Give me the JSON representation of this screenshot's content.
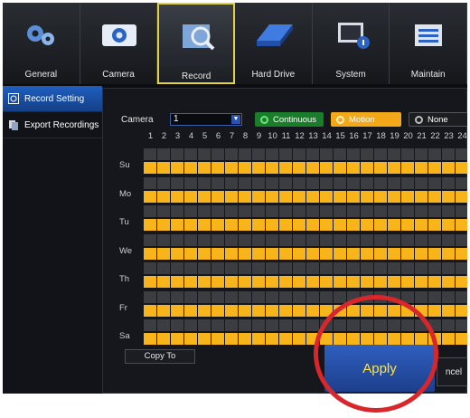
{
  "topbar": {
    "tabs": [
      {
        "label": "General",
        "icon": "gears-icon"
      },
      {
        "label": "Camera",
        "icon": "camera-icon"
      },
      {
        "label": "Record",
        "icon": "record-magnifier-icon"
      },
      {
        "label": "Hard Drive",
        "icon": "hard-drive-icon"
      },
      {
        "label": "System",
        "icon": "system-info-icon"
      },
      {
        "label": "Maintain",
        "icon": "maintain-sliders-icon"
      }
    ],
    "active_tab": "Record"
  },
  "sidebar": {
    "items": [
      {
        "label": "Record Setting",
        "icon": "record-setting-icon"
      },
      {
        "label": "Export Recordings",
        "icon": "export-icon"
      }
    ]
  },
  "schedule": {
    "camera_label": "Camera",
    "camera_value": "1",
    "modes": [
      {
        "label": "Continuous",
        "color": "#1a7d2a"
      },
      {
        "label": "Motion",
        "color": "#f3a81a"
      },
      {
        "label": "None",
        "color": "#1c1d21"
      }
    ],
    "hours": [
      "1",
      "2",
      "3",
      "4",
      "5",
      "6",
      "7",
      "8",
      "9",
      "10",
      "11",
      "12",
      "13",
      "14",
      "15",
      "16",
      "17",
      "18",
      "19",
      "20",
      "21",
      "22",
      "23",
      "24"
    ],
    "days": [
      "Su",
      "Mo",
      "Tu",
      "We",
      "Th",
      "Fr",
      "Sa"
    ],
    "selected_mode_color": "#f8b51b"
  },
  "buttons": {
    "copy_to": "Copy To",
    "apply": "Apply",
    "cancel": "ncel"
  },
  "colors": {
    "active_tab_border": "#e4d23a",
    "sidebar_active": "#1f5fbf",
    "apply_text": "#ffe447",
    "highlight_ring": "#d8262a"
  }
}
